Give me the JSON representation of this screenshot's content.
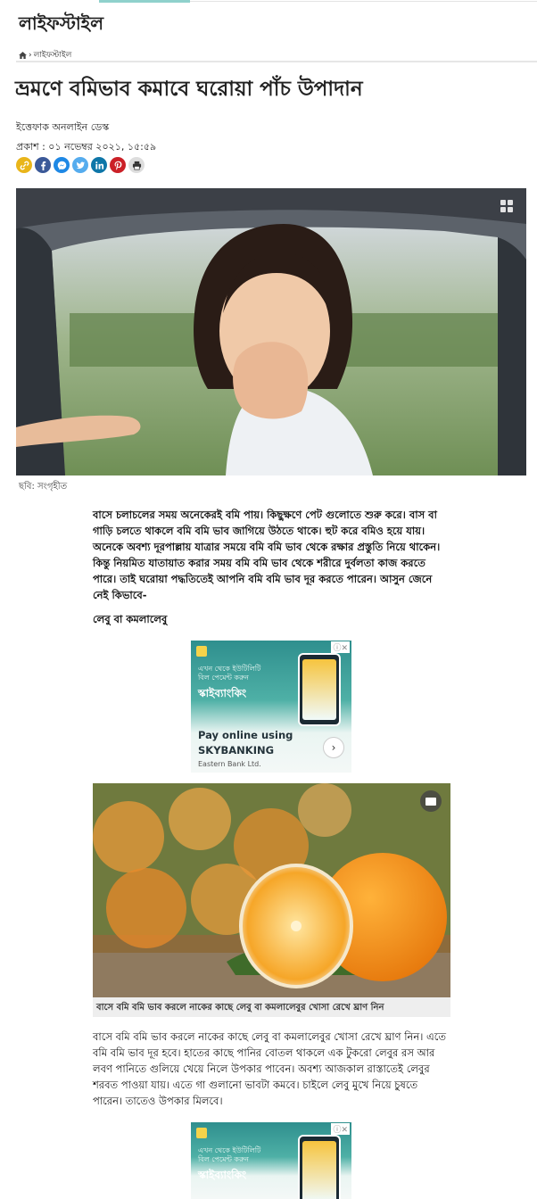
{
  "section": {
    "title": "লাইফস্টাইল"
  },
  "breadcrumb": {
    "items": [
      "লাইফস্টাইল"
    ]
  },
  "article": {
    "headline": "ভ্রমণে বমিভাব কমাবে ঘরোয়া পাঁচ উপাদান",
    "author": "ইত্তেফাক অনলাইন ডেস্ক",
    "published": "প্রকাশ : ০১ নভেম্বর ২০২১, ১৫:৫৯",
    "hero_caption": "ছবি: সংগৃহীত",
    "paragraph1": "বাসে চলাচলের সময় অনেকেরই বমি পায়। কিছুক্ষণে পেট গুলোতে শুরু করে। বাস বা গাড়ি চলতে থাকলে বমি বমি ভাব জাগিয়ে উঠতে থাকে। হুট করে বমিও হয়ে যায়। অনেকে অবশ্য দূরপাল্লায় যাত্রার সময়ে বমি বমি ভাব থেকে রক্ষার প্রস্তুতি নিয়ে থাকেন। কিন্তু নিয়মিত যাতায়াত করার সময় বমি বমি ভাব থেকে শরীরে দুর্বলতা কাজ করতে পারে। তাই ঘরোয়া পদ্ধতিতেই আপনি বমি বমি ভাব দূর করতে পারেন। আসুন জেনে নেই কিভাবে-",
    "subheading": "লেবু বা কমলালেবু",
    "figure2_caption": "বাসে বমি বমি ভাব করলে নাকের কাছে লেবু বা কমলালেবুর খোসা রেখে ঘ্রাণ নিন",
    "paragraph2": "বাসে বমি বমি ভাব করলে নাকের কাছে লেবু বা কমলালেবুর খোসা রেখে ঘ্রাণ নিন। এতে বমি বমি ভাব দূর হবে। হাতের কাছে পানির বোতল থাকলে এক টুকরো লেবুর রস আর লবণ পানিতে গুলিয়ে খেয়ে নিলে উপকার পাবেন। অবশ্য আজকাল রাস্তাতেই লেবুর শরবত পাওয়া যায়। এতে গা গুলানো ভাবটা কমবে। চাইলে লেবু মুখে নিয়ে চুষতে পারেন। তাতেও উপকার মিলবে।"
  },
  "ad": {
    "headline": "এখন থেকে ইউটিলিটি বিল পেমেন্ট করুন",
    "brand": "স্কাইব্যাংকিং",
    "cta": "Pay online using SKYBANKING",
    "sponsor": "Eastern Bank Ltd.",
    "close": "ⓘ✕"
  },
  "icons": {
    "share": [
      "link-icon",
      "facebook-icon",
      "messenger-icon",
      "twitter-icon",
      "linkedin-icon",
      "pinterest-icon",
      "print-icon"
    ]
  },
  "colors": {
    "accent_teal": "#8fd1cc",
    "link": "#e9b51a",
    "facebook": "#3b5998",
    "messenger": "#1e88e5",
    "twitter": "#55acee",
    "linkedin": "#0e76a8",
    "pinterest": "#cb2027",
    "print": "#dddddd"
  }
}
